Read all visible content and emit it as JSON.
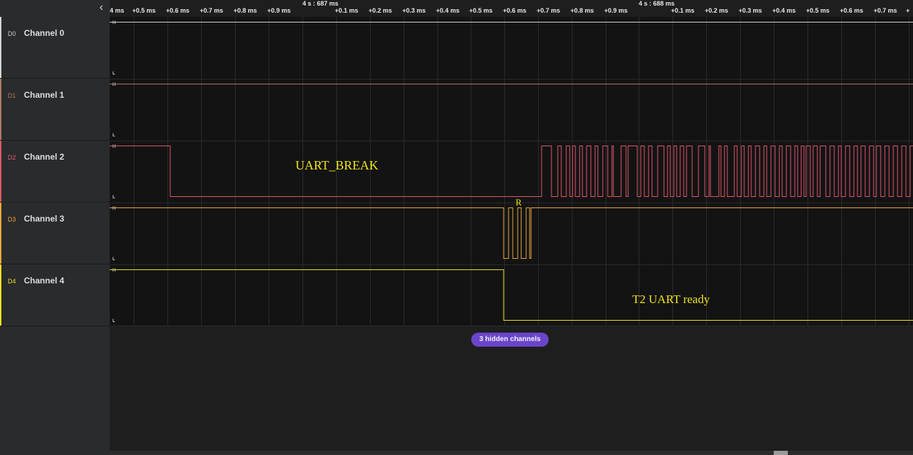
{
  "sidebar": {
    "collapse_icon": "chevron-left-icon",
    "channels": [
      {
        "id": "D0",
        "name": "Channel 0",
        "color": "#d4d4d4"
      },
      {
        "id": "D1",
        "name": "Channel 1",
        "color": "#b07a60"
      },
      {
        "id": "D2",
        "name": "Channel 2",
        "color": "#e0576a"
      },
      {
        "id": "D3",
        "name": "Channel 3",
        "color": "#e7a93a"
      },
      {
        "id": "D4",
        "name": "Channel 4",
        "color": "#f0e020"
      }
    ]
  },
  "ruler": {
    "major_labels": [
      "4 s : 687 ms",
      "4 s : 688 ms"
    ],
    "tick_labels": [
      "4 ms",
      "+0.5 ms",
      "+0.6 ms",
      "+0.7 ms",
      "+0.8 ms",
      "+0.9 ms",
      "+0.1 ms",
      "+0.2 ms",
      "+0.3 ms",
      "+0.4 ms",
      "+0.5 ms",
      "+0.6 ms",
      "+0.7 ms",
      "+0.8 ms",
      "+0.9 ms",
      "+0.1 ms",
      "+0.2 ms",
      "+0.3 ms",
      "+0.4 ms",
      "+0.5 ms",
      "+0.6 ms",
      "+0.7 ms",
      "+"
    ]
  },
  "levels": {
    "high": "H",
    "low": "L"
  },
  "annotations": {
    "uart_break": "UART_BREAK",
    "r_marker": "R",
    "t2_ready": "T2 UART ready"
  },
  "hidden_channels_label": "3 hidden channels",
  "colors": {
    "ch0": "#d4d4d4",
    "ch1": "#b07a60",
    "ch2": "#e0576a",
    "ch3": "#e7a93a",
    "ch4": "#f0e020",
    "annotation": "#f1e41a",
    "accent": "#6a45c8"
  }
}
